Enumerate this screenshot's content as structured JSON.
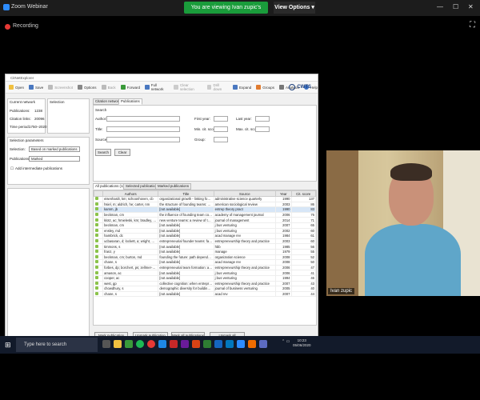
{
  "zoom": {
    "title": "Zoom Webinar",
    "banner": "You are viewing Ivan zupic's screen",
    "view_options": "View Options",
    "recording": "Recording"
  },
  "app": {
    "title": "CitNetExplorer",
    "toolbar": [
      "Open",
      "Save",
      "Screenshot",
      "Options",
      "Back",
      "Forward",
      "Full network",
      "Clear selection",
      "Drill down",
      "Expand",
      "Groups",
      "Analysis",
      "Help"
    ],
    "brand": "CWTS",
    "current_network": {
      "heading": "Current network",
      "pubs_label": "Publications:",
      "pubs_value": "1238",
      "links_label": "Citation links:",
      "links_value": "20096",
      "period_label": "Time period:",
      "period_value": "1750–2020"
    },
    "selection_heading": "Selection",
    "selection_params": {
      "heading": "Selection parameters",
      "selection_label": "Selection:",
      "selection_value": "Based on marked publications",
      "pubs_label": "Publications:",
      "pubs_value": "Marked",
      "add_intermediate": "Add intermediate publications"
    },
    "tabs": [
      "Citation network",
      "Publications"
    ],
    "search": {
      "heading": "Search",
      "author_label": "Author:",
      "title_label": "Title:",
      "source_label": "Source:",
      "first_year": "First year:",
      "last_year": "Last year:",
      "min_cit": "Min. cit. score:",
      "max_cit": "Max. cit. score:",
      "group": "Group:",
      "search_btn": "Search",
      "clear_btn": "Clear"
    },
    "pub_tabs": [
      "All publications (1238)",
      "Selected publications",
      "Marked publications"
    ],
    "columns": [
      "Authors",
      "Title",
      "Source",
      "Year",
      "Cit. score"
    ],
    "rows": [
      [
        "eisenhardt, km; schoonhoven, cb",
        "organizational growth - linking founding ...",
        "administrative science quarterly",
        "1990",
        "137"
      ],
      [
        "hsiel, m; aldrich, he; carter, nm",
        "the structure of founding teams: homoph...",
        "american sociological review",
        "2003",
        "86"
      ],
      [
        "kamm, jb",
        "[not available]",
        "entrep theory pract",
        "1990",
        "83"
      ],
      [
        "beckman, cm",
        "the influence of founding team company a...",
        "academy of management journal",
        "2006",
        "76"
      ],
      [
        "klotz, ac; hmieleski, km; bradley, bh; busen...",
        "new venture teams: a review of the literatu...",
        "journal of management",
        "2014",
        "71"
      ],
      [
        "beckman, cm",
        "[not available]",
        "j bus venturing",
        "2007",
        "65"
      ],
      [
        "ensley, md",
        "[not available]",
        "j bus venturing",
        "2002",
        "60"
      ],
      [
        "hambrick, dc",
        "[not available]",
        "acad manage rev",
        "1984",
        "61"
      ],
      [
        "ucbasaran, d; lockett, a; wright, m; westhe...",
        "entrepreneurial founder teams: factors ass...",
        "entrepreneurship theory and practice",
        "2003",
        "60"
      ],
      [
        "timmons, s",
        "[not available]",
        "hbb",
        "1985",
        "56"
      ],
      [
        "franz, y",
        "[not available]",
        "manage",
        "1979",
        "55"
      ],
      [
        "beckman, cm; burton, md",
        "founding the future: path dependence in ...",
        "organization science",
        "2008",
        "52"
      ],
      [
        "chane, s",
        "[not available]",
        "acad manage rev",
        "2008",
        "50"
      ],
      [
        "forbes, dp; borchert, ps; zellmer-bruhn, me...",
        "entrepreneurial team formation: an explor...",
        "entrepreneurship theory and practice",
        "2006",
        "47"
      ],
      [
        "amason, ac",
        "[not available]",
        "j bus venturing",
        "2006",
        "41"
      ],
      [
        "cooper, ac",
        "[not available]",
        "j bus venturing",
        "1994",
        "46"
      ],
      [
        "west, gp",
        "collective cognition: when entrepreneurial...",
        "entrepreneurship theory and practice",
        "2007",
        "43"
      ],
      [
        "chowdhury, s",
        "demographic diversity for building an effe...",
        "journal of business venturing",
        "2005",
        "40"
      ],
      [
        "chane, s",
        "[not available]",
        "acad rev",
        "2007",
        "44"
      ]
    ],
    "actions": [
      "Mark publication",
      "Unmark publication",
      "Mark all publications",
      "Unmark all publications"
    ]
  },
  "video": {
    "participant_name": "Ivan zupic"
  },
  "taskbar": {
    "search": "Type here to search",
    "time": "10:23",
    "date": "05/06/2020"
  }
}
